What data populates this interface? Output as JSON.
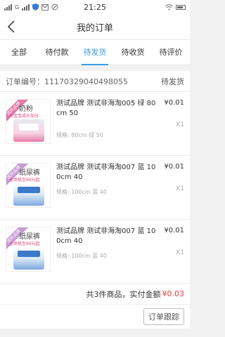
{
  "statusbar": {
    "time": "21:25",
    "left_text": "G",
    "right_icons": [
      "wifi-icon",
      "battery-icon"
    ]
  },
  "navbar": {
    "title": "我的订单",
    "back_icon": "chevron-left-icon"
  },
  "tabs": [
    {
      "label": "全部",
      "active": false
    },
    {
      "label": "待付款",
      "active": false
    },
    {
      "label": "待发货",
      "active": true
    },
    {
      "label": "待收货",
      "active": false
    },
    {
      "label": "待评价",
      "active": false
    }
  ],
  "order": {
    "number_label": "订单编号：11170329040498055",
    "status": "待发货",
    "items": [
      {
        "name": "测试品牌 测试非海淘005 绿 80cm 50",
        "price": "¥0.01",
        "spec": "规格:  80cm 绿 50",
        "qty": "X1",
        "thumb_category": "奶粉",
        "thumb_sub": "为宝宝成长加分",
        "thumb_ribbon": "国际品牌"
      },
      {
        "name": "测试品牌 测试非海淘007 蓝 100cm 40",
        "price": "¥0.01",
        "spec": "规格:  100cm 蓝 40",
        "qty": "X1",
        "thumb_category": "纸尿裤",
        "thumb_sub": "全场低至69元起",
        "thumb_ribbon": "国际品牌"
      },
      {
        "name": "测试品牌 测试非海淘007 蓝 100cm 40",
        "price": "¥0.01",
        "spec": "规格:  100cm 蓝 40",
        "qty": "X1",
        "thumb_category": "纸尿裤",
        "thumb_sub": "全场低至69元起",
        "thumb_ribbon": "国际品牌"
      }
    ],
    "summary_prefix": "共3件商品，实付金额",
    "summary_amount": "¥0.03",
    "track_button": "订单跟踪"
  },
  "colors": {
    "accent": "#3a9de0",
    "price_red": "#e4393c"
  }
}
